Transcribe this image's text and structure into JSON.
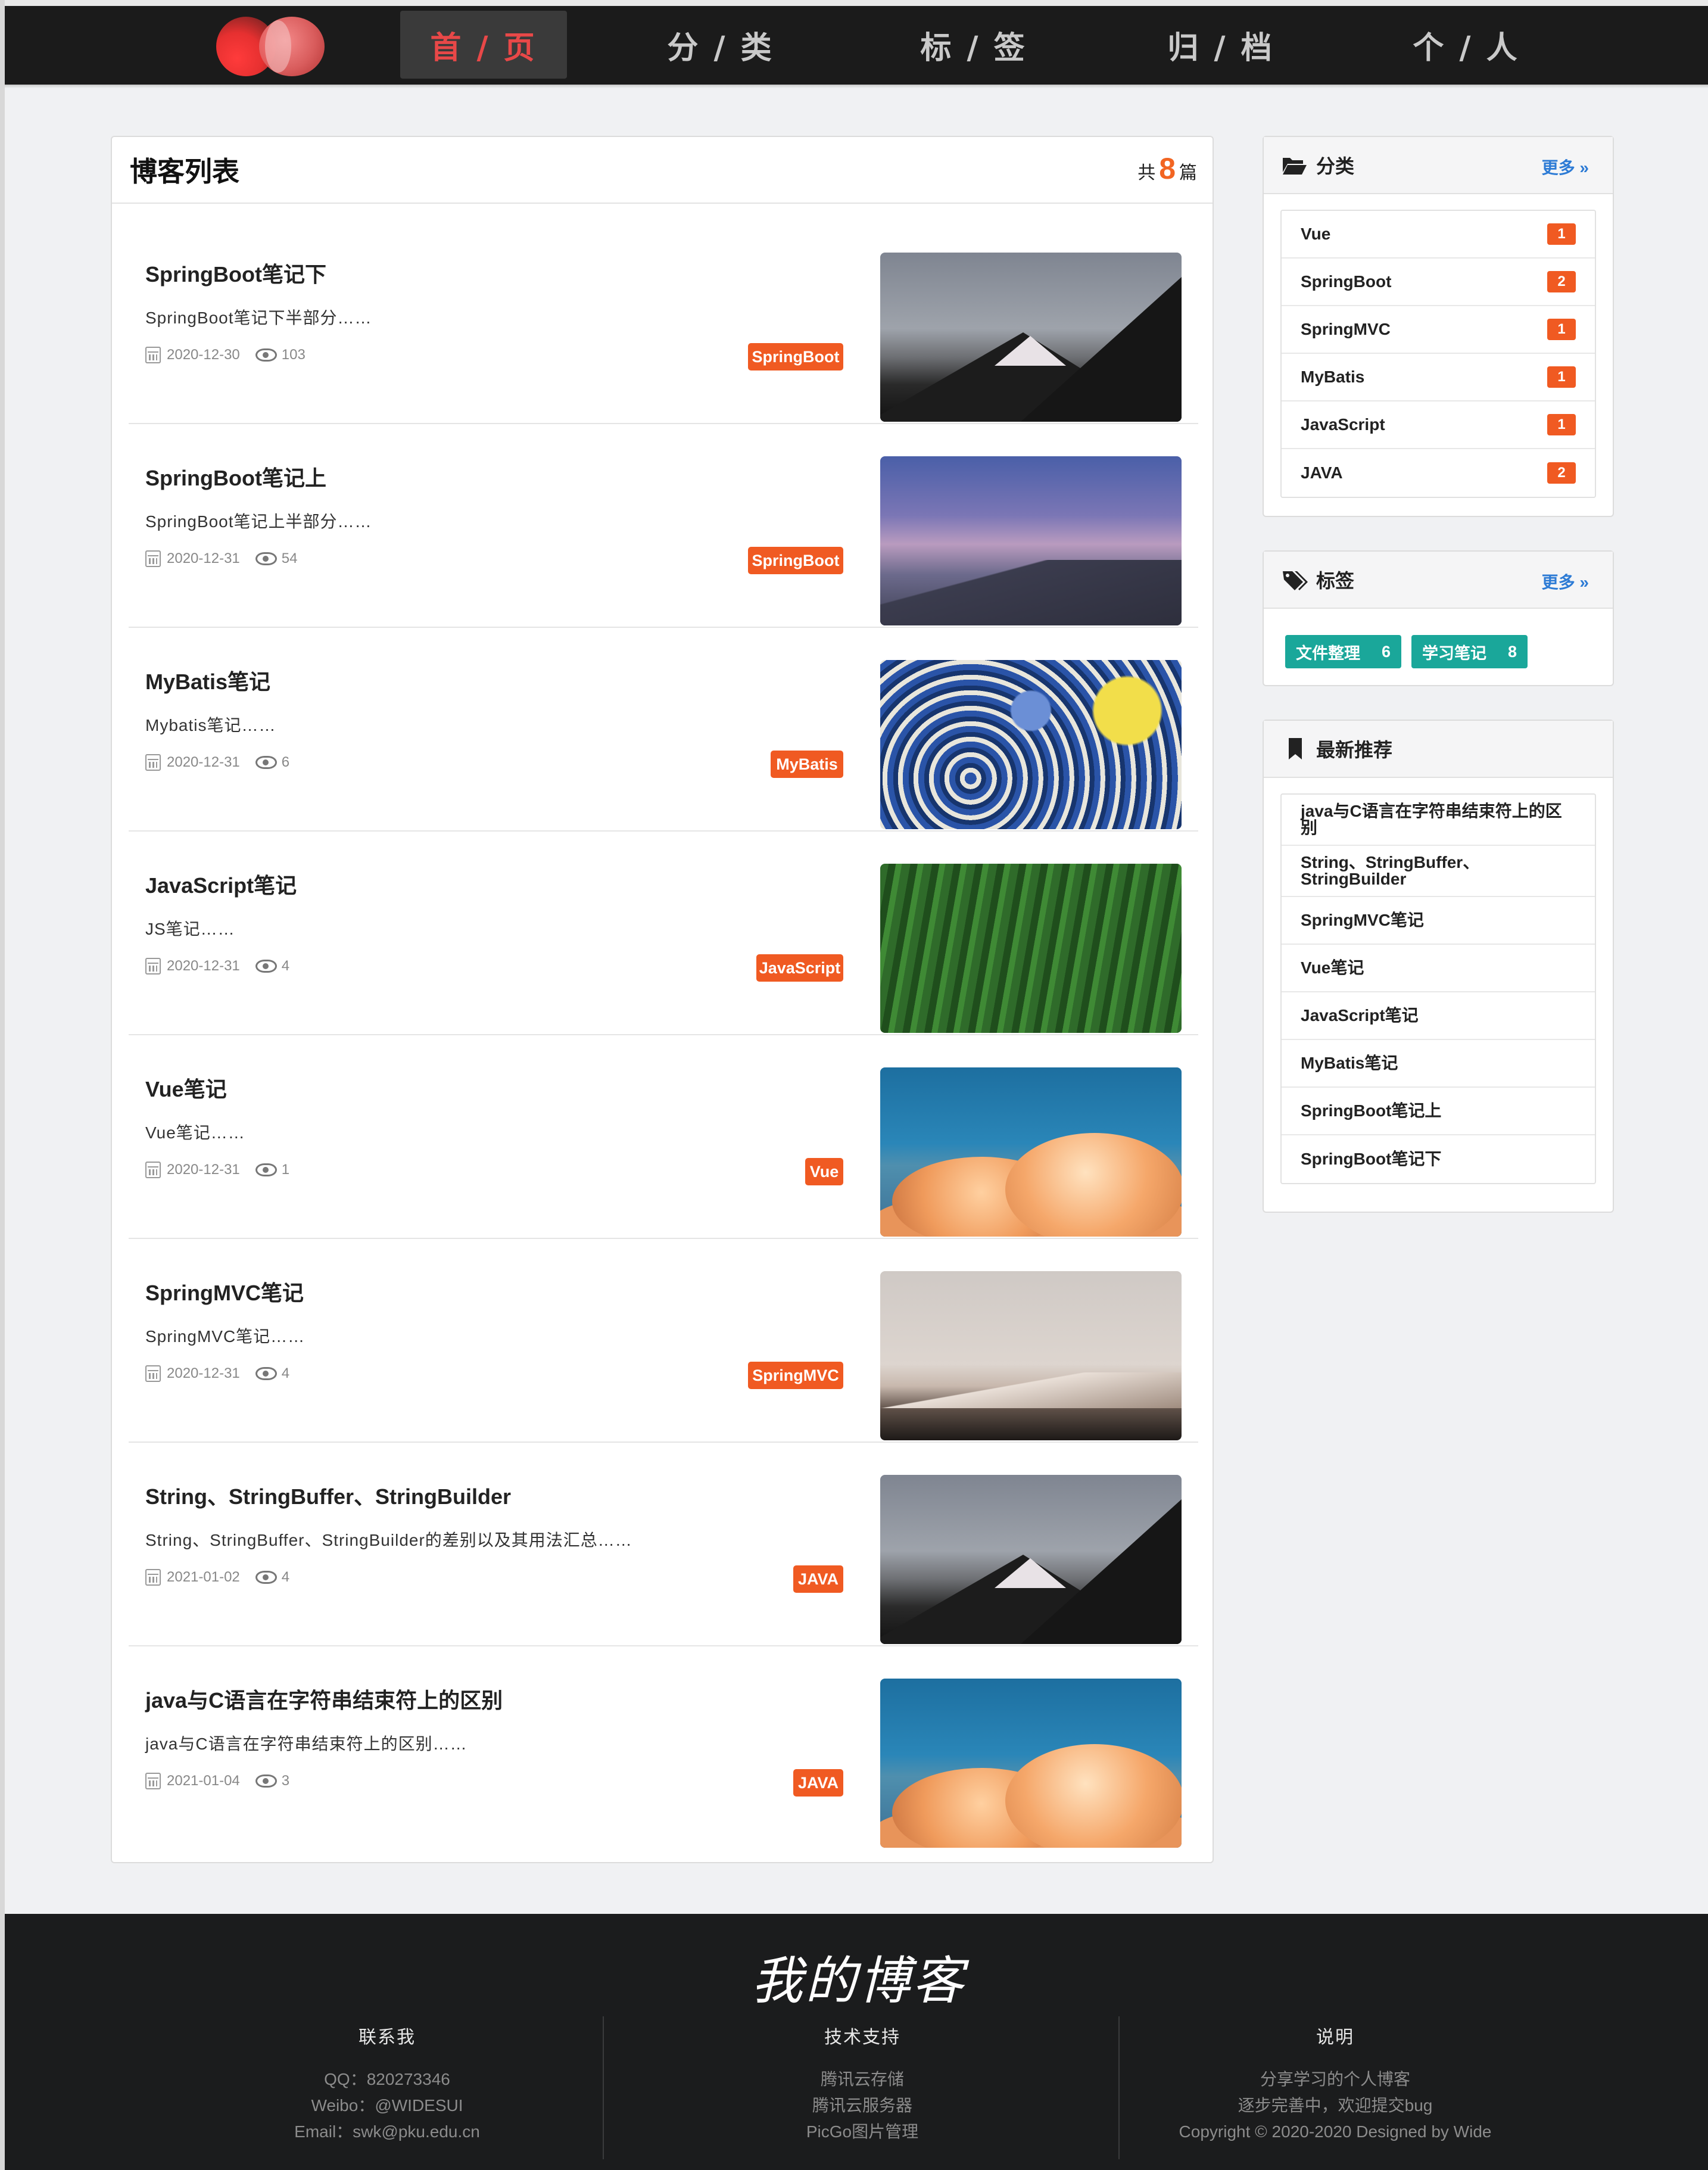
{
  "nav": {
    "items": [
      {
        "label": "首 / 页",
        "active": true
      },
      {
        "label": "分 / 类",
        "active": false
      },
      {
        "label": "标 / 签",
        "active": false
      },
      {
        "label": "归 / 档",
        "active": false
      },
      {
        "label": "个 / 人",
        "active": false
      }
    ]
  },
  "blog_list": {
    "title": "博客列表",
    "count_prefix": "共",
    "count": "8",
    "count_suffix": "篇",
    "posts": [
      {
        "title": "SpringBoot笔记下",
        "desc": "SpringBoot笔记下半部分……",
        "date": "2020-12-30",
        "views": "103",
        "tag": "SpringBoot",
        "image": "mountain-dark"
      },
      {
        "title": "SpringBoot笔记上",
        "desc": "SpringBoot笔记上半部分……",
        "date": "2020-12-31",
        "views": "54",
        "tag": "SpringBoot",
        "image": "dusk"
      },
      {
        "title": "MyBatis笔记",
        "desc": "Mybatis笔记……",
        "date": "2020-12-31",
        "views": "6",
        "tag": "MyBatis",
        "image": "wave"
      },
      {
        "title": "JavaScript笔记",
        "desc": "JS笔记……",
        "date": "2020-12-31",
        "views": "4",
        "tag": "JavaScript",
        "image": "forest"
      },
      {
        "title": "Vue笔记",
        "desc": "Vue笔记……",
        "date": "2020-12-31",
        "views": "1",
        "tag": "Vue",
        "image": "clouds"
      },
      {
        "title": "SpringMVC笔记",
        "desc": "SpringMVC笔记……",
        "date": "2020-12-31",
        "views": "4",
        "tag": "SpringMVC",
        "image": "snowrange"
      },
      {
        "title": "String、StringBuffer、StringBuilder",
        "desc": "String、StringBuffer、StringBuilder的差别以及其用法汇总……",
        "date": "2021-01-02",
        "views": "4",
        "tag": "JAVA",
        "image": "mountain-dark"
      },
      {
        "title": "java与C语言在字符串结束符上的区别",
        "desc": "java与C语言在字符串结束符上的区别……",
        "date": "2021-01-04",
        "views": "3",
        "tag": "JAVA",
        "image": "clouds"
      }
    ]
  },
  "sidebar": {
    "categories": {
      "title": "分类",
      "more": "更多 »",
      "items": [
        {
          "name": "Vue",
          "count": "1"
        },
        {
          "name": "SpringBoot",
          "count": "2"
        },
        {
          "name": "SpringMVC",
          "count": "1"
        },
        {
          "name": "MyBatis",
          "count": "1"
        },
        {
          "name": "JavaScript",
          "count": "1"
        },
        {
          "name": "JAVA",
          "count": "2"
        }
      ]
    },
    "tags": {
      "title": "标签",
      "more": "更多 »",
      "items": [
        {
          "name": "文件整理",
          "count": "6"
        },
        {
          "name": "学习笔记",
          "count": "8"
        }
      ]
    },
    "recommend": {
      "title": "最新推荐",
      "items": [
        "java与C语言在字符串结束符上的区别",
        "String、StringBuffer、StringBuilder",
        "SpringMVC笔记",
        "Vue笔记",
        "JavaScript笔记",
        "MyBatis笔记",
        "SpringBoot笔记上",
        "SpringBoot笔记下"
      ]
    }
  },
  "footer": {
    "logo": "我的博客",
    "contact": {
      "title": "联系我",
      "lines": [
        "QQ：820273346",
        "Weibo：@WIDESUI",
        "Email：swk@pku.edu.cn"
      ]
    },
    "support": {
      "title": "技术支持",
      "lines": [
        "腾讯云存储",
        "腾讯云服务器",
        "PicGo图片管理"
      ]
    },
    "about": {
      "title": "说明",
      "lines": [
        "分享学习的个人博客",
        "逐步完善中，欢迎提交bug",
        "Copyright © 2020-2020 Designed by Wide"
      ]
    }
  },
  "colors": {
    "accent": "#f05a22",
    "tag_teal": "#1aa79a",
    "link_blue": "#2d7bd5",
    "nav_bg": "#1b1b1b",
    "active_red": "#e84848"
  }
}
